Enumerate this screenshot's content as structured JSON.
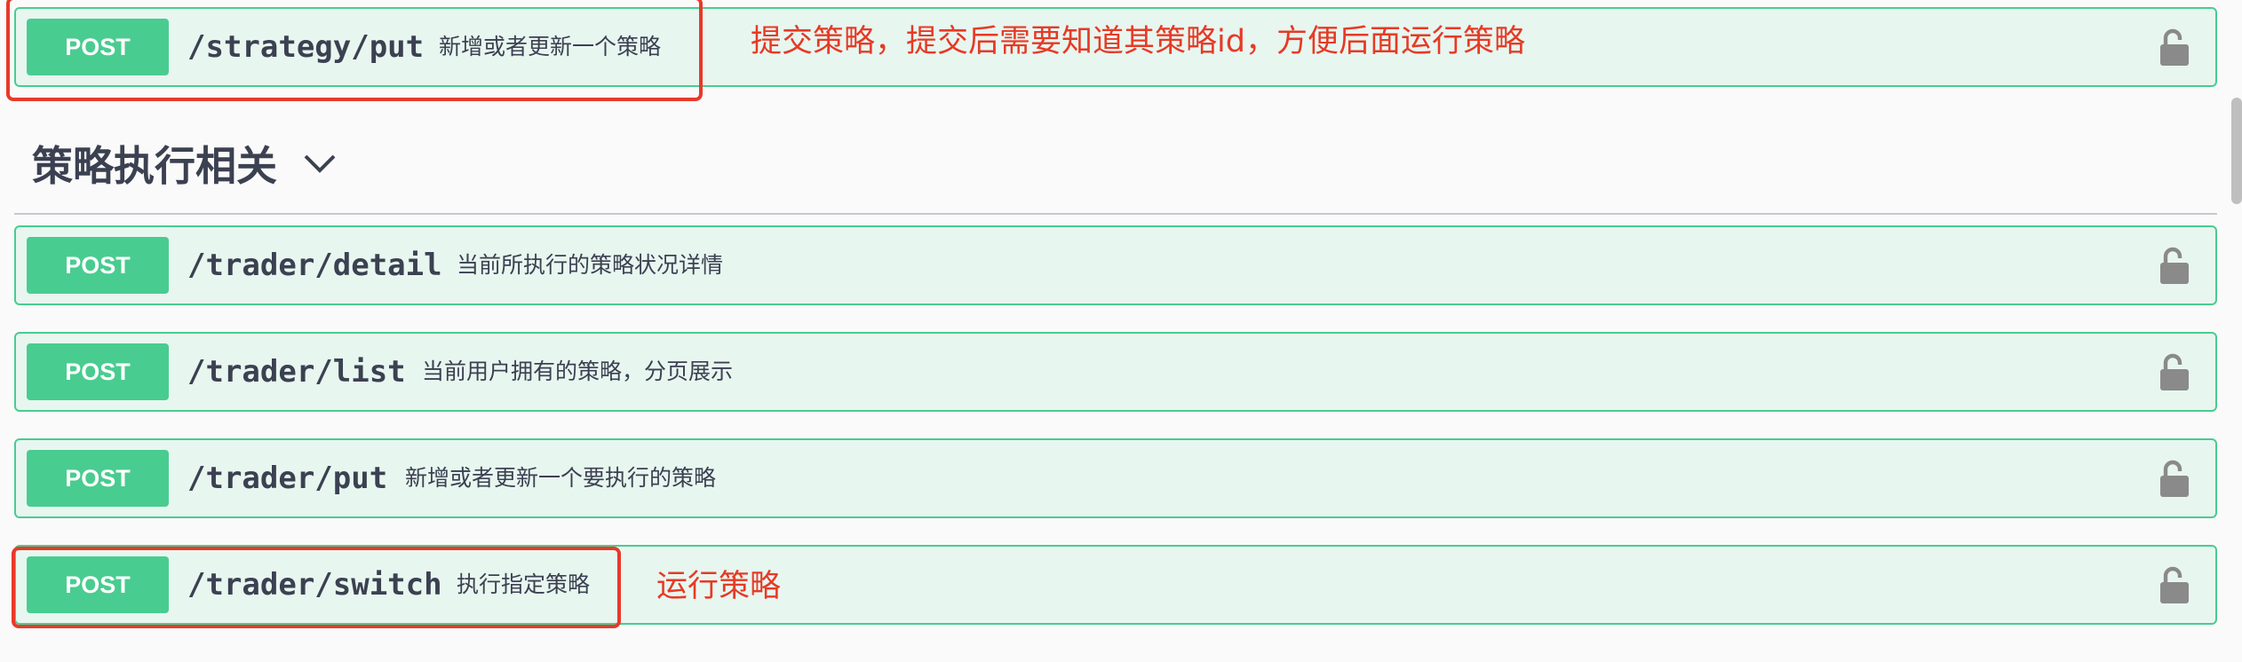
{
  "top_block": {
    "method": "POST",
    "path": "/strategy/put",
    "summary": "新增或者更新一个策略"
  },
  "section": {
    "title": "策略执行相关",
    "chevron_icon": "chevron-down-icon"
  },
  "endpoints": [
    {
      "method": "POST",
      "path": "/trader/detail",
      "summary": "当前所执行的策略状况详情"
    },
    {
      "method": "POST",
      "path": "/trader/list",
      "summary": "当前用户拥有的策略，分页展示"
    },
    {
      "method": "POST",
      "path": "/trader/put",
      "summary": "新增或者更新一个要执行的策略"
    },
    {
      "method": "POST",
      "path": "/trader/switch",
      "summary": "执行指定策略"
    }
  ],
  "annotations": {
    "top_note": "提交策略，提交后需要知道其策略id，方便后面运行策略",
    "switch_note": "运行策略"
  },
  "icons": {
    "lock": "unlocked-padlock-icon"
  },
  "colors": {
    "post_green": "#49cc90",
    "block_bg": "#e8f6f0",
    "annotation_red": "#e8392a",
    "text_dark": "#3b4151"
  }
}
